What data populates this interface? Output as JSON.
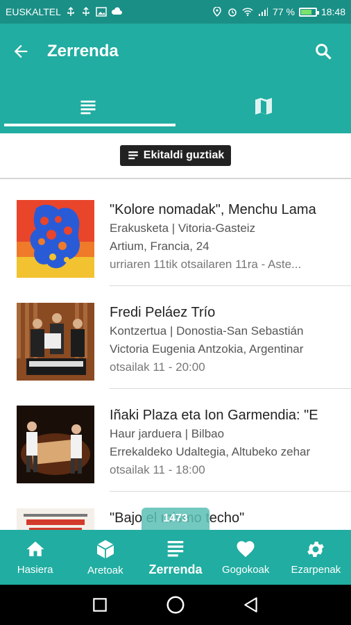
{
  "status_bar": {
    "carrier": "EUSKALTEL",
    "battery": "77 %",
    "time": "18:48",
    "battery_level": 0.77
  },
  "app_bar": {
    "title": "Zerrenda"
  },
  "tabs": [
    {
      "name": "list-icon"
    },
    {
      "name": "map-icon"
    }
  ],
  "filter": {
    "label": "Ekitaldi guztiak"
  },
  "events": [
    {
      "title": "\"Kolore nomadak\", Menchu Lama",
      "category": "Erakusketa | Vitoria-Gasteiz",
      "venue": "Artium, Francia, 24",
      "date": "urriaren 11tik otsailaren 11ra - Aste..."
    },
    {
      "title": "Fredi Peláez Trío",
      "category": "Kontzertua | Donostia-San Sebastián",
      "venue": "Victoria Eugenia Antzokia, Argentinar",
      "date": "otsailak 11 - 20:00"
    },
    {
      "title": "Iñaki Plaza eta Ion Garmendia: \"E",
      "category": "Haur jarduera | Bilbao",
      "venue": "Errekaldeko Udaltegia, Altubeko zehar",
      "date": "otsailak 11 - 18:00"
    },
    {
      "title": "\"Bajo el mismo techo\"",
      "category": "",
      "venue": "",
      "date": ""
    }
  ],
  "count_badge": "1473",
  "bottom_nav": [
    {
      "label": "Hasiera",
      "icon": "home-icon"
    },
    {
      "label": "Aretoak",
      "icon": "cube-icon"
    },
    {
      "label": "Zerrenda",
      "icon": "list-icon"
    },
    {
      "label": "Gogokoak",
      "icon": "heart-icon"
    },
    {
      "label": "Ezarpenak",
      "icon": "gear-icon"
    }
  ],
  "colors": {
    "primary": "#21ada1",
    "status_bar": "#1a8f86",
    "chip": "#222222"
  }
}
